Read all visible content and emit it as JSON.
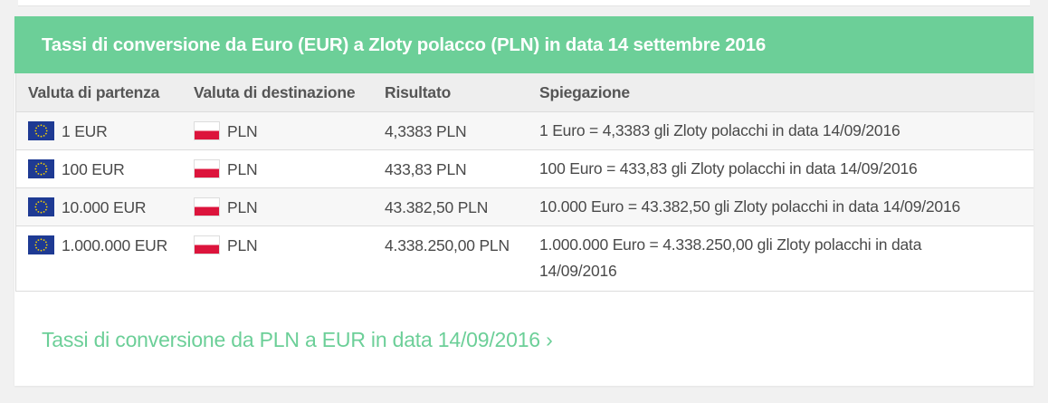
{
  "header": {
    "title": "Tassi di conversione da Euro (EUR) a Zloty polacco (PLN) in data 14 settembre 2016"
  },
  "table": {
    "columns": [
      "Valuta di partenza",
      "Valuta di destinazione",
      "Risultato",
      "Spiegazione"
    ],
    "rows": [
      {
        "from": "1 EUR",
        "to": "PLN",
        "result": "4,3383 PLN",
        "explanation": "1 Euro = 4,3383 gli Zloty polacchi in data 14/09/2016"
      },
      {
        "from": "100 EUR",
        "to": "PLN",
        "result": "433,83 PLN",
        "explanation": "100 Euro = 433,83 gli Zloty polacchi in data 14/09/2016"
      },
      {
        "from": "10.000 EUR",
        "to": "PLN",
        "result": "43.382,50 PLN",
        "explanation": "10.000 Euro = 43.382,50 gli Zloty polacchi in data 14/09/2016"
      },
      {
        "from": "1.000.000 EUR",
        "to": "PLN",
        "result": "4.338.250,00 PLN",
        "explanation": "1.000.000 Euro = 4.338.250,00 gli Zloty polacchi in data 14/09/2016"
      }
    ]
  },
  "link": {
    "label": "Tassi di conversione da PLN a EUR in data 14/09/2016 ›"
  },
  "colors": {
    "accent": "#6ccf98",
    "eu_blue": "#1e3a93",
    "eu_star": "#f6d000",
    "pl_red": "#dc143c"
  },
  "icons": {
    "from_flag": "eu-flag-icon",
    "to_flag": "poland-flag-icon"
  }
}
